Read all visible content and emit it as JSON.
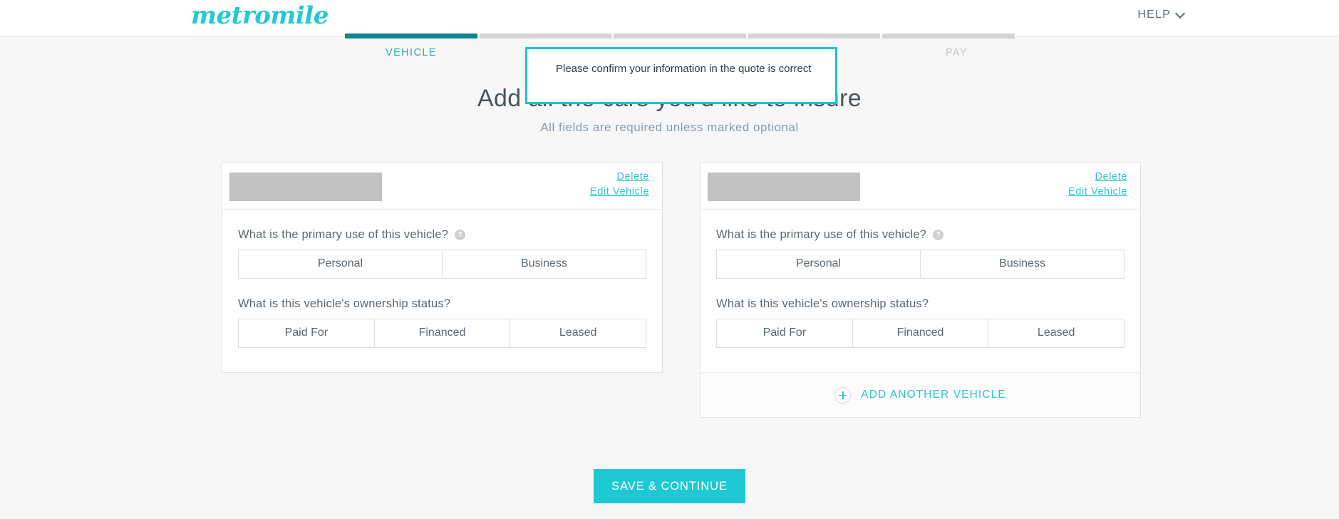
{
  "header": {
    "logo_text": "metromile",
    "help_label": "HELP",
    "chevron_icon": "chevron-down-icon"
  },
  "progress": {
    "segments": [
      {
        "label": "VEHICLE",
        "state": "done"
      },
      {
        "label": "",
        "state": "todo"
      },
      {
        "label": "",
        "state": "todo"
      },
      {
        "label": "",
        "state": "todo"
      },
      {
        "label": "PAY",
        "state": "todo"
      }
    ],
    "active_color": "#12838e",
    "inactive_color": "#d4d4d4",
    "step_vehicle": "VEHICLE",
    "step_pay": "PAY"
  },
  "tooltip": {
    "text": "Please confirm your information in the quote is correct",
    "border_color": "#1fc2cd"
  },
  "page": {
    "title": "Add all the cars you'd like to insure",
    "subtitle": "All fields are required unless marked optional"
  },
  "vehicles": [
    {
      "name_redacted": "",
      "delete_label": "Delete",
      "edit_label": "Edit Vehicle",
      "primary_use": {
        "question": "What is the primary use of this vehicle?",
        "info_icon": "question-mark-icon",
        "options": [
          "Personal",
          "Business"
        ],
        "selected": null
      },
      "ownership": {
        "question": "What is this vehicle's ownership status?",
        "options": [
          "Paid For",
          "Financed",
          "Leased"
        ],
        "selected": null
      }
    },
    {
      "name_redacted": "",
      "delete_label": "Delete",
      "edit_label": "Edit Vehicle",
      "primary_use": {
        "question": "What is the primary use of this vehicle?",
        "info_icon": "question-mark-icon",
        "options": [
          "Personal",
          "Business"
        ],
        "selected": null
      },
      "ownership": {
        "question": "What is this vehicle's ownership status?",
        "options": [
          "Paid For",
          "Financed",
          "Leased"
        ],
        "selected": null
      }
    }
  ],
  "add_another": {
    "label": "ADD ANOTHER VEHICLE",
    "plus_icon": "plus-circle-icon"
  },
  "cta": {
    "label": "SAVE & CONTINUE",
    "color": "#1fc9d4"
  }
}
